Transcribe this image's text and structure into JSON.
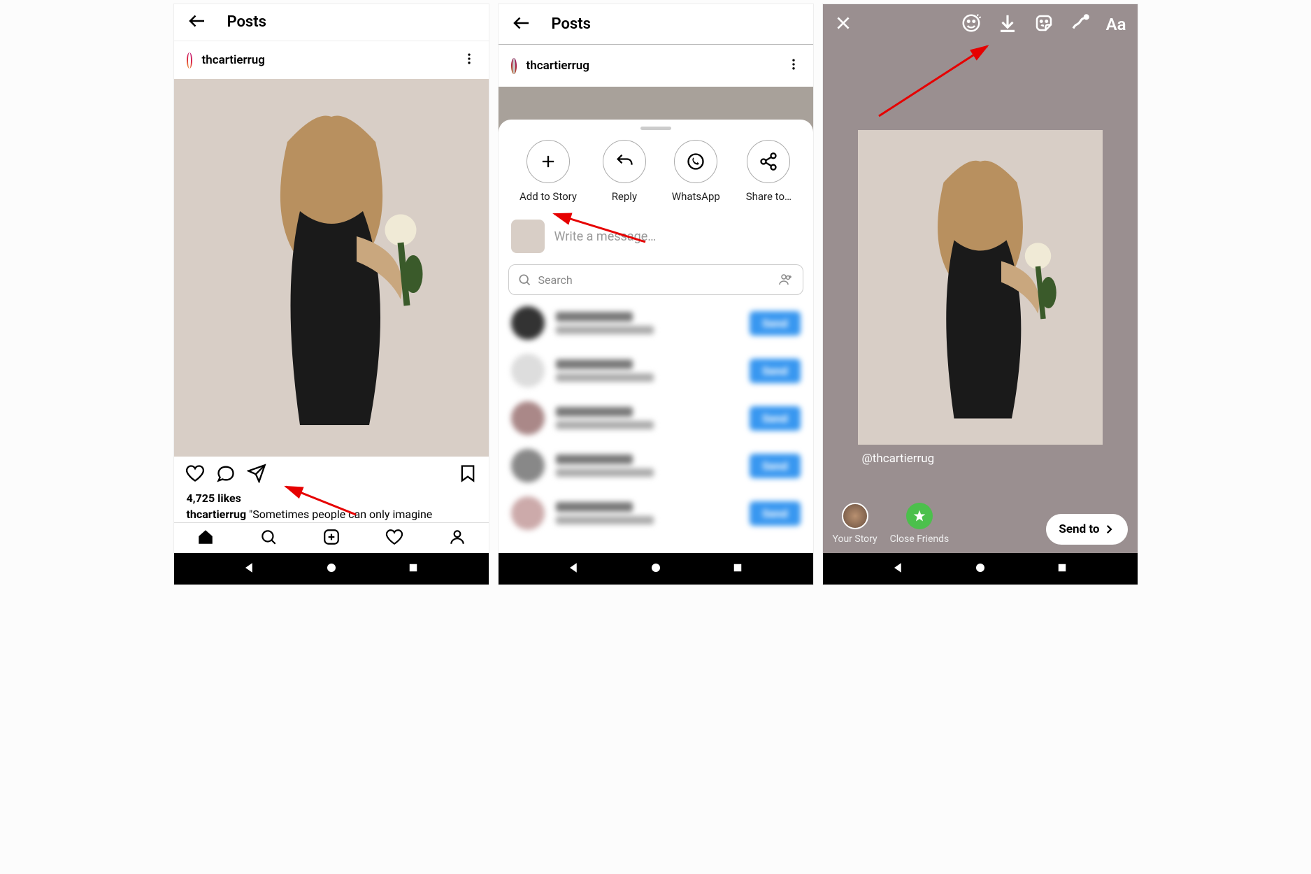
{
  "screen1": {
    "header_title": "Posts",
    "username": "thcartierrug",
    "likes": "4,725 likes",
    "caption": "\"Sometimes people can only imagine"
  },
  "screen2": {
    "header_title": "Posts",
    "username": "thcartierrug",
    "share_actions": {
      "add_to_story": "Add to Story",
      "reply": "Reply",
      "whatsapp": "WhatsApp",
      "share_to": "Share to…"
    },
    "message_placeholder": "Write a message…",
    "search_placeholder": "Search",
    "send_label": "Send"
  },
  "screen3": {
    "tag": "@thcartierrug",
    "text_tool": "Aa",
    "your_story": "Your Story",
    "close_friends": "Close Friends",
    "send_to": "Send to"
  }
}
